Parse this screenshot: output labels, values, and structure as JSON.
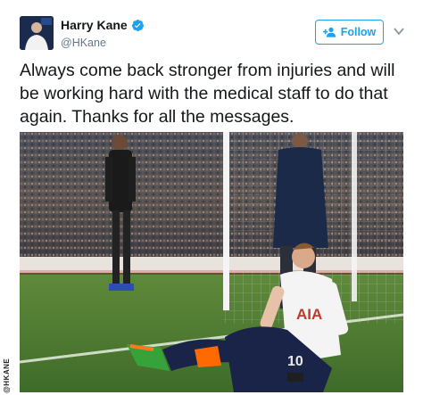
{
  "user": {
    "display_name": "Harry Kane",
    "handle": "@HKane",
    "verified": true
  },
  "actions": {
    "follow_label": "Follow",
    "follow_icon": "add-user-icon",
    "menu_icon": "chevron-down-icon"
  },
  "tweet": {
    "text": "Always come back stronger from injuries and will be working hard with the medical staff to do that again. Thanks for all the messages."
  },
  "photo": {
    "shirt_text": "AIA",
    "shirt_number": "10",
    "credit": "@HKANE"
  },
  "colors": {
    "accent": "#1da1f2",
    "text": "#14171a",
    "muted": "#657786",
    "pitch": "#3f6b2a"
  }
}
